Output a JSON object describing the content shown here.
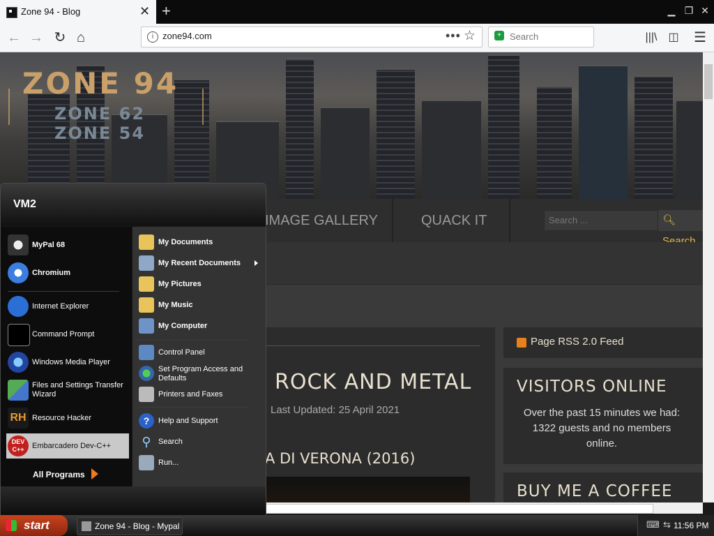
{
  "browser": {
    "tab_title": "Zone 94 - Blog",
    "url": "zone94.com",
    "search_placeholder": "Search"
  },
  "site": {
    "logo_main": "ZONE 94",
    "logo_line2": "ZONE 62",
    "logo_line3": "ZONE 54",
    "menu": [
      "IMAGE GALLERY",
      "QUACK IT"
    ],
    "search_placeholder": "Search ...",
    "search_button": "Search",
    "article_title": "ROCK AND METAL",
    "article_updated": "Last Updated: 25 April 2021",
    "article_subtitle": "A DI VERONA (2016)",
    "rss_label": "Page RSS 2.0 Feed",
    "visitors_title": "VISITORS ONLINE",
    "visitors_text": "Over the past 15 minutes we had: 1322 guests and no members online.",
    "coffee_title": "BUY ME A COFFEE"
  },
  "start_menu": {
    "user": "VM2",
    "pinned": [
      {
        "label": "MyPal 68",
        "icon": "mypal-icon"
      },
      {
        "label": "Chromium",
        "icon": "chromium-icon"
      }
    ],
    "recent": [
      {
        "label": "Internet Explorer",
        "icon": "ie-icon"
      },
      {
        "label": "Command Prompt",
        "icon": "cmd-icon"
      },
      {
        "label": "Windows Media Player",
        "icon": "wmp-icon"
      },
      {
        "label": "Files and Settings Transfer Wizard",
        "icon": "transfer-wizard-icon"
      },
      {
        "label": "Resource Hacker",
        "icon": "resource-hacker-icon"
      },
      {
        "label": "Embarcadero Dev-C++",
        "icon": "devcpp-icon"
      }
    ],
    "all_programs": "All Programs",
    "right": [
      {
        "label": "My Documents",
        "icon": "folder-icon"
      },
      {
        "label": "My Recent Documents",
        "icon": "recent-docs-icon"
      },
      {
        "label": "My Pictures",
        "icon": "pictures-folder-icon"
      },
      {
        "label": "My Music",
        "icon": "music-folder-icon"
      },
      {
        "label": "My Computer",
        "icon": "computer-icon"
      },
      {
        "label": "Control Panel",
        "icon": "control-panel-icon"
      },
      {
        "label": "Set Program Access and Defaults",
        "icon": "program-defaults-icon"
      },
      {
        "label": "Printers and Faxes",
        "icon": "printer-icon"
      },
      {
        "label": "Help and Support",
        "icon": "help-icon"
      },
      {
        "label": "Search",
        "icon": "search-icon"
      },
      {
        "label": "Run...",
        "icon": "run-icon"
      }
    ]
  },
  "taskbar": {
    "start_label": "start",
    "task_label": "Zone 94 - Blog - Mypal",
    "clock": "11:56 PM"
  }
}
